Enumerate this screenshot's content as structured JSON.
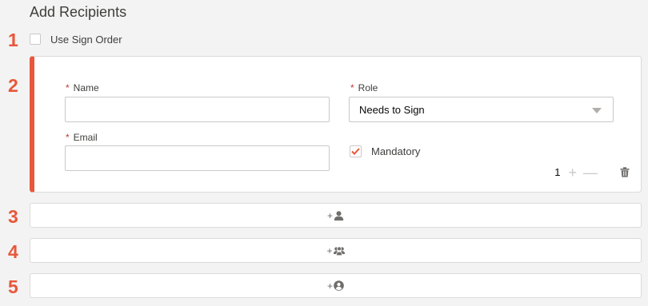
{
  "header": {
    "title": "Add Recipients"
  },
  "step_numbers": [
    "1",
    "2",
    "3",
    "4",
    "5"
  ],
  "sign_order": {
    "label": "Use Sign Order",
    "checked": false
  },
  "recipient": {
    "name_label": "Name",
    "name_value": "",
    "role_label": "Role",
    "role_value": "Needs to Sign",
    "email_label": "Email",
    "email_value": "",
    "required_marker": "*",
    "mandatory_label": "Mandatory",
    "mandatory_checked": true,
    "order_number": "1",
    "plus_label": "+",
    "minus_label": "—",
    "icons": [
      "trash-icon",
      "chevron-down-icon",
      "checkmark-icon"
    ]
  },
  "add_buttons": [
    {
      "plus": "+",
      "icon": "user-icon"
    },
    {
      "plus": "+",
      "icon": "group-icon"
    },
    {
      "plus": "+",
      "icon": "contact-icon"
    }
  ],
  "colors": {
    "accent": "#e8573a",
    "required": "#c23934",
    "border": "#dddbda",
    "background": "#f3f3f3"
  }
}
